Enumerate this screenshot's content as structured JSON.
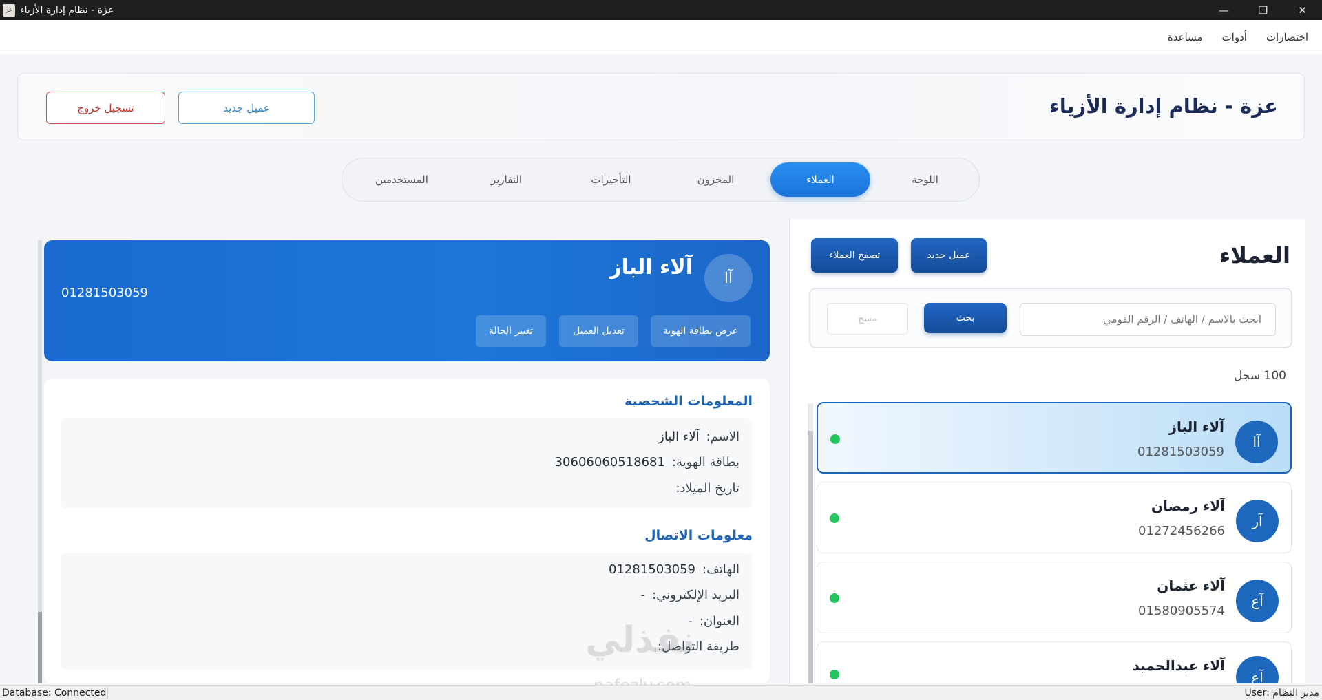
{
  "window": {
    "title": "عزة - نظام إدارة الأزياء",
    "icon_text": "عز",
    "minimize": "—",
    "maximize": "❐",
    "close": "✕"
  },
  "menu": [
    "مساعدة",
    "أدوات",
    "اختصارات"
  ],
  "header": {
    "title": "عزة - نظام إدارة الأزياء",
    "new_client": "عميل جديد",
    "logout": "تسجيل خروج"
  },
  "tabs": [
    {
      "label": "اللوحة",
      "active": false
    },
    {
      "label": "العملاء",
      "active": true
    },
    {
      "label": "المخزون",
      "active": false
    },
    {
      "label": "التأجيرات",
      "active": false
    },
    {
      "label": "التقارير",
      "active": false
    },
    {
      "label": "المستخدمين",
      "active": false
    }
  ],
  "clients": {
    "title": "العملاء",
    "new_client": "عميل جديد",
    "browse": "تصفح العملاء",
    "search_placeholder": "ابحث بالاسم / الهاتف / الرقم القومي",
    "search_button": "بحث",
    "clear_button": "مسح",
    "record_count": "100 سجل",
    "items": [
      {
        "initials": "آا",
        "name": "آلاء الباز",
        "phone": "01281503059",
        "selected": true
      },
      {
        "initials": "آر",
        "name": "آلاء رمضان",
        "phone": "01272456266",
        "selected": false
      },
      {
        "initials": "آع",
        "name": "آلاء عثمان",
        "phone": "01580905574",
        "selected": false
      },
      {
        "initials": "آع",
        "name": "آلاء عبدالحميد",
        "phone": "",
        "selected": false
      }
    ]
  },
  "details": {
    "initials": "آا",
    "name": "آلاء الباز",
    "phone": "01281503059",
    "buttons": {
      "id_card": "عرض بطاقة الهوية",
      "edit": "تعديل العميل",
      "status": "تغيير الحالة"
    },
    "personal": {
      "title": "المعلومات الشخصية",
      "name_label": "الاسم:",
      "name_value": "آلاء الباز",
      "id_label": "بطاقة الهوية:",
      "id_value": "30606060518681",
      "birth_label": "تاريخ الميلاد:",
      "birth_value": ""
    },
    "contact": {
      "title": "معلومات الاتصال",
      "phone_label": "الهاتف:",
      "phone_value": "01281503059",
      "email_label": "البريد الإلكتروني:",
      "email_value": "-",
      "address_label": "العنوان:",
      "address_value": "-",
      "method_label": "طريقة التواصل:",
      "method_value": ""
    }
  },
  "watermark": {
    "main": "نفذلي",
    "sub": "nafezly.com"
  },
  "status": {
    "db": "Database: Connected",
    "user": "User: مدير النظام"
  }
}
